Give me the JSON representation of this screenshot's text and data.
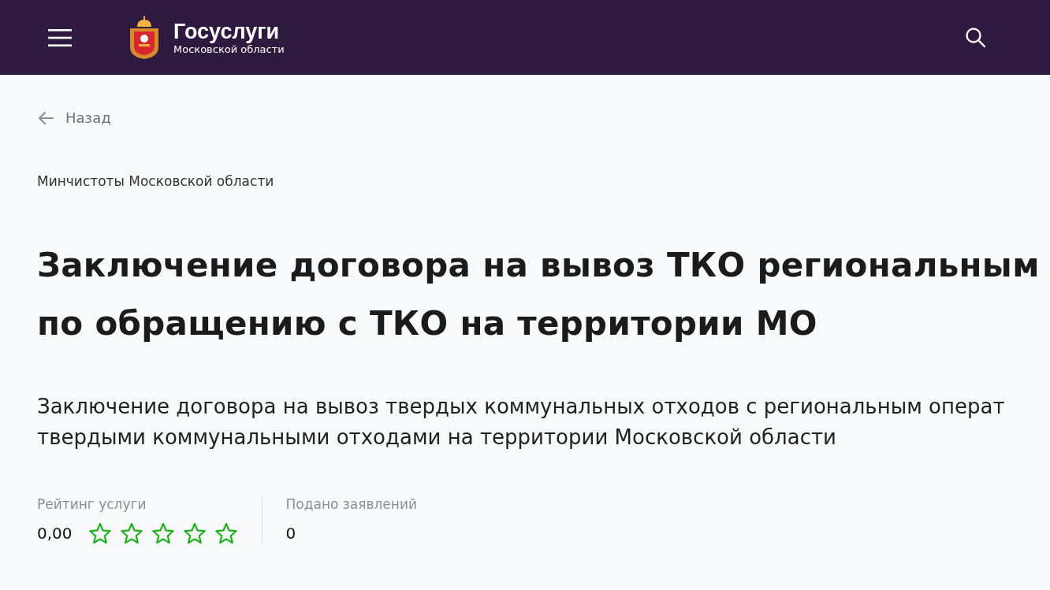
{
  "header": {
    "brand": "Госуслуги",
    "region": "Московской области"
  },
  "back_link": "Назад",
  "department": "Минчистоты Московской области",
  "title_lines": [
    "Заключение договора на вывоз ТКО региональным",
    "по обращению с ТКО на территории МО"
  ],
  "description_lines": [
    "Заключение договора на вывоз твердых коммунальных отходов с региональным операт",
    "твердыми коммунальными отходами на территории Московской области"
  ],
  "rating": {
    "label": "Рейтинг услуги",
    "value": "0,00",
    "stars": 0
  },
  "applications": {
    "label": "Подано заявлений",
    "value": "0"
  }
}
